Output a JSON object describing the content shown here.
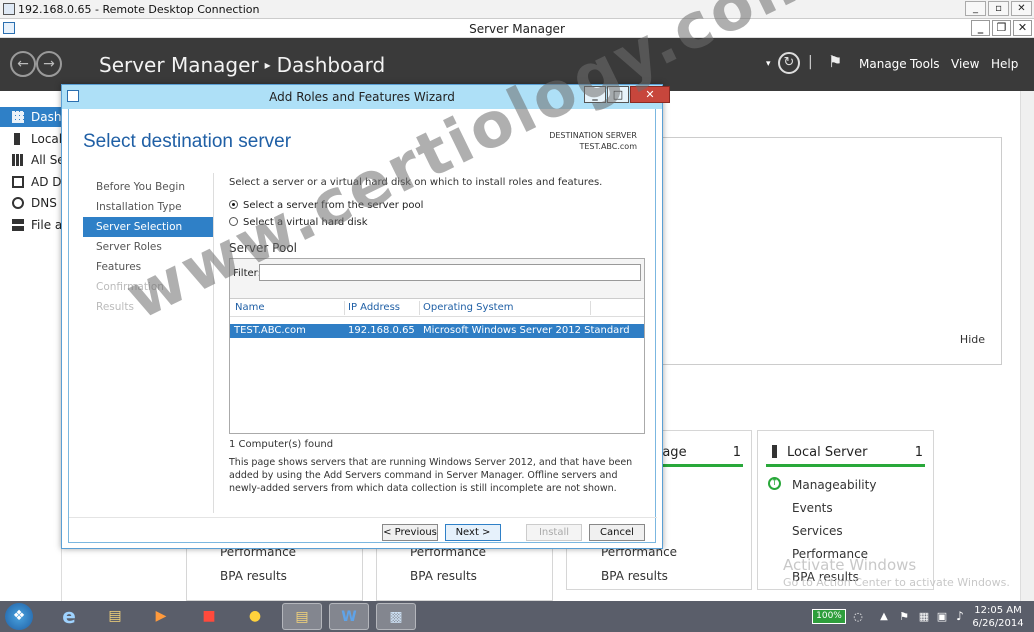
{
  "rdp": {
    "title": "192.168.0.65 - Remote Desktop Connection",
    "btn_min": "_",
    "btn_max": "▫",
    "btn_close": "✕"
  },
  "window": {
    "title": "Server Manager",
    "btn_min": "_",
    "btn_max": "❐",
    "btn_close": "✕"
  },
  "header": {
    "app": "Server Manager",
    "separator": "▸",
    "page": "Dashboard",
    "tools": [
      "Manage",
      "Tools",
      "View",
      "Help"
    ]
  },
  "nav": {
    "items": [
      {
        "label": "Dashboard"
      },
      {
        "label": "Local Server"
      },
      {
        "label": "All Servers"
      },
      {
        "label": "AD DS"
      },
      {
        "label": "DNS"
      },
      {
        "label": "File and Storage Services"
      }
    ]
  },
  "welcome": {
    "hide": "Hide"
  },
  "tiles": {
    "storage_title": "rage",
    "storage_count": "1",
    "local_title": "Local Server",
    "local_count": "1",
    "local_lines": [
      "Manageability",
      "Events",
      "Services",
      "Performance",
      "BPA results"
    ],
    "bottom": [
      "Performance",
      "BPA results"
    ]
  },
  "activation": {
    "line1": "Activate Windows",
    "line2": "Go to Action Center to activate Windows."
  },
  "wizard": {
    "title": "Add Roles and Features Wizard",
    "btn_min": "_",
    "btn_max": "□",
    "btn_close": "✕",
    "heading": "Select destination server",
    "dest_label": "DESTINATION SERVER",
    "dest_value": "TEST.ABC.com",
    "steps": [
      {
        "label": "Before You Begin"
      },
      {
        "label": "Installation Type"
      },
      {
        "label": "Server Selection"
      },
      {
        "label": "Server Roles"
      },
      {
        "label": "Features"
      },
      {
        "label": "Confirmation"
      },
      {
        "label": "Results"
      }
    ],
    "instruction": "Select a server or a virtual hard disk on which to install roles and features.",
    "option_pool": "Select a server from the server pool",
    "option_vhd": "Select a virtual hard disk",
    "pool_label": "Server Pool",
    "filter_label": "Filter:",
    "filter_value": "",
    "columns": [
      "Name",
      "IP Address",
      "Operating System"
    ],
    "rows": [
      {
        "name": "TEST.ABC.com",
        "ip": "192.168.0.65",
        "os": "Microsoft Windows Server 2012 Standard"
      }
    ],
    "count": "1 Computer(s) found",
    "description": "This page shows servers that are running Windows Server 2012, and that have been added by using the Add Servers command in Server Manager. Offline servers and newly-added servers from which data collection is still incomplete are not shown.",
    "btn_previous": "< Previous",
    "btn_next": "Next >",
    "btn_install": "Install",
    "btn_cancel": "Cancel"
  },
  "watermark": "www.certiology.com",
  "taskbar": {
    "battery": "100%",
    "time": "12:05 AM",
    "date": "6/26/2014"
  }
}
